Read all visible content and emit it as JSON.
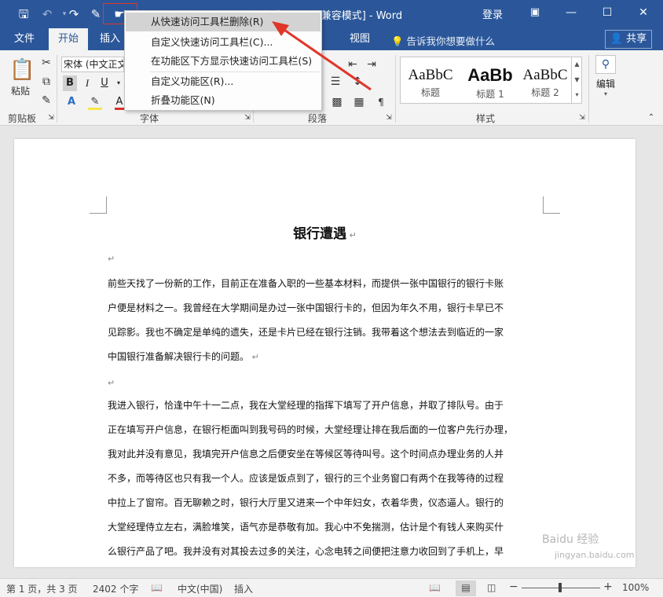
{
  "titlebar": {
    "title": "银行遭遇.doc [兼容模式] - Word",
    "login": "登录"
  },
  "tabs": [
    {
      "label": "文件"
    },
    {
      "label": "开始"
    },
    {
      "label": "插入"
    },
    {
      "label": "视图"
    }
  ],
  "tellme": "告诉我你想要做什么",
  "share": "共享",
  "ribbon": {
    "paste_label": "粘贴",
    "font_name": "宋体 (中文正文",
    "bold": "B",
    "italic": "I",
    "underline": "U",
    "groups": {
      "clipboard": "剪贴板",
      "font": "字体",
      "paragraph": "段落",
      "styles": "样式"
    },
    "styles": [
      {
        "sample": "AaBbC",
        "name": "标题"
      },
      {
        "sample": "AaBb",
        "name": "标题 1"
      },
      {
        "sample": "AaBbC",
        "name": "标题 2"
      }
    ],
    "edit_label": "编辑"
  },
  "menu": {
    "items": [
      {
        "label": "从快速访问工具栏删除(R)"
      },
      {
        "label": "自定义快速访问工具栏(C)..."
      },
      {
        "label": "在功能区下方显示快速访问工具栏(S)"
      },
      {
        "label": "自定义功能区(R)..."
      },
      {
        "label": "折叠功能区(N)"
      }
    ]
  },
  "document": {
    "title": "银行遭遇",
    "paragraphs": [
      [
        "前些天找了一份新的工作，目前正在准备入职的一些基本材料，而提供一张中国银行的银行卡账",
        "户便是材料之一。我曾经在大学期间是办过一张中国银行卡的，但因为年久不用，银行卡早已不",
        "见踪影。我也不确定是单纯的遗失，还是卡片已经在银行注销。我带着这个想法去到临近的一家",
        "中国银行准备解决银行卡的问题。"
      ],
      [
        "我进入银行，恰逢中午十一二点，我在大堂经理的指挥下填写了开户信息，并取了排队号。由于",
        "正在填写开户信息，在银行柜面叫到我号码的时候，大堂经理让排在我后面的一位客户先行办理，",
        "我对此并没有意见，我填完开户信息之后便安坐在等候区等待叫号。这个时间点办理业务的人并",
        "不多，而等待区也只有我一个人。应该是饭点到了，银行的三个业务窗口有两个在我等待的过程",
        "中拉上了窗帘。百无聊赖之时，银行大厅里又进来一个中年妇女，衣着华贵，仪态逼人。银行的",
        "大堂经理侍立左右，满脸堆笑，语气亦是恭敬有加。我心中不免揣测，估计是个有钱人来购买什",
        "么银行产品了吧。我并没有对其投去过多的关注，心念电转之间便把注意力收回到了手机上，早"
      ]
    ]
  },
  "status": {
    "page": "第 1 页，共 3 页",
    "words": "2402 个字",
    "language": "中文(中国)",
    "mode": "插入",
    "zoom": "100%"
  },
  "watermark": {
    "main": "Baidu 经验",
    "sub": "jingyan.baidu.com"
  }
}
